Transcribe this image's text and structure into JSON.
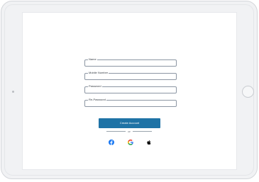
{
  "form": {
    "name_label": "Name",
    "mobile_label": "Mobile Number",
    "password_label": "Password",
    "repassword_label": "Re-Password",
    "name_value": "",
    "mobile_value": "",
    "password_value": "",
    "repassword_value": ""
  },
  "actions": {
    "create_label": "Create Account",
    "or_text": "or"
  },
  "social": [
    "facebook-icon",
    "google-icon",
    "apple-icon"
  ],
  "colors": {
    "primary": "#1f73a6",
    "facebook": "#1877f2",
    "google_red": "#ea4335",
    "google_yellow": "#fbbc05",
    "google_green": "#34a853",
    "google_blue": "#4285f4",
    "apple": "#111111"
  }
}
